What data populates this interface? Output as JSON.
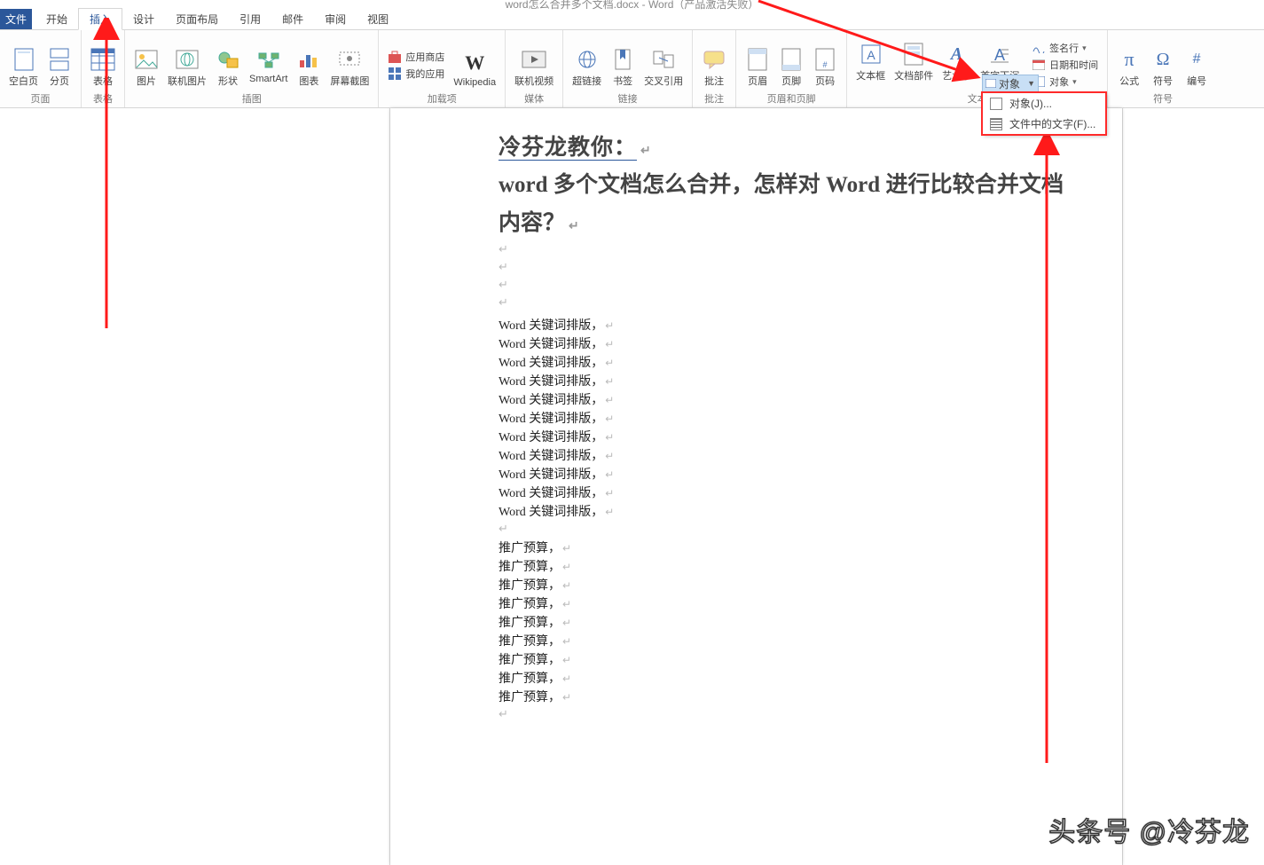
{
  "title": "word怎么合并多个文档.docx - Word（产品激活失败）",
  "tabs": {
    "file": "文件",
    "home": "开始",
    "insert": "插入",
    "design": "设计",
    "layout": "页面布局",
    "references": "引用",
    "mailings": "邮件",
    "review": "审阅",
    "view": "视图"
  },
  "ribbon": {
    "pages": {
      "label": "页面",
      "blank": "空白页",
      "break": "分页"
    },
    "tables": {
      "label": "表格",
      "btn": "表格"
    },
    "illus": {
      "label": "插图",
      "pic": "图片",
      "online_pic": "联机图片",
      "shapes": "形状",
      "smartart": "SmartArt",
      "chart": "图表",
      "screenshot": "屏幕截图"
    },
    "addins": {
      "label": "加载项",
      "store": "应用商店",
      "myapps": "我的应用",
      "wiki": "Wikipedia"
    },
    "media": {
      "label": "媒体",
      "video": "联机视频"
    },
    "links": {
      "label": "链接",
      "hyperlink": "超链接",
      "bookmark": "书签",
      "cross": "交叉引用"
    },
    "comments": {
      "label": "批注",
      "btn": "批注"
    },
    "headerfooter": {
      "label": "页眉和页脚",
      "header": "页眉",
      "footer": "页脚",
      "pagenum": "页码"
    },
    "text": {
      "label": "文本",
      "textbox": "文本框",
      "quickparts": "文档部件",
      "wordart": "艺术字",
      "dropcap": "首字下沉",
      "sigline": "签名行",
      "datetime": "日期和时间",
      "object": "对象"
    },
    "symbols": {
      "label": "符号",
      "equation": "公式",
      "symbol": "符号",
      "number": "编号"
    }
  },
  "dropdown": {
    "trigger": "对象",
    "item1": "对象(J)...",
    "item2": "文件中的文字(F)..."
  },
  "document": {
    "h1a": "冷芬龙教你：",
    "h2": "word 多个文档怎么合并，怎样对 Word 进行比较合并文档内容？",
    "line_kw": "Word 关键词排版，",
    "line_bg": "推广预算，"
  },
  "watermark": "头条号 @冷芬龙"
}
